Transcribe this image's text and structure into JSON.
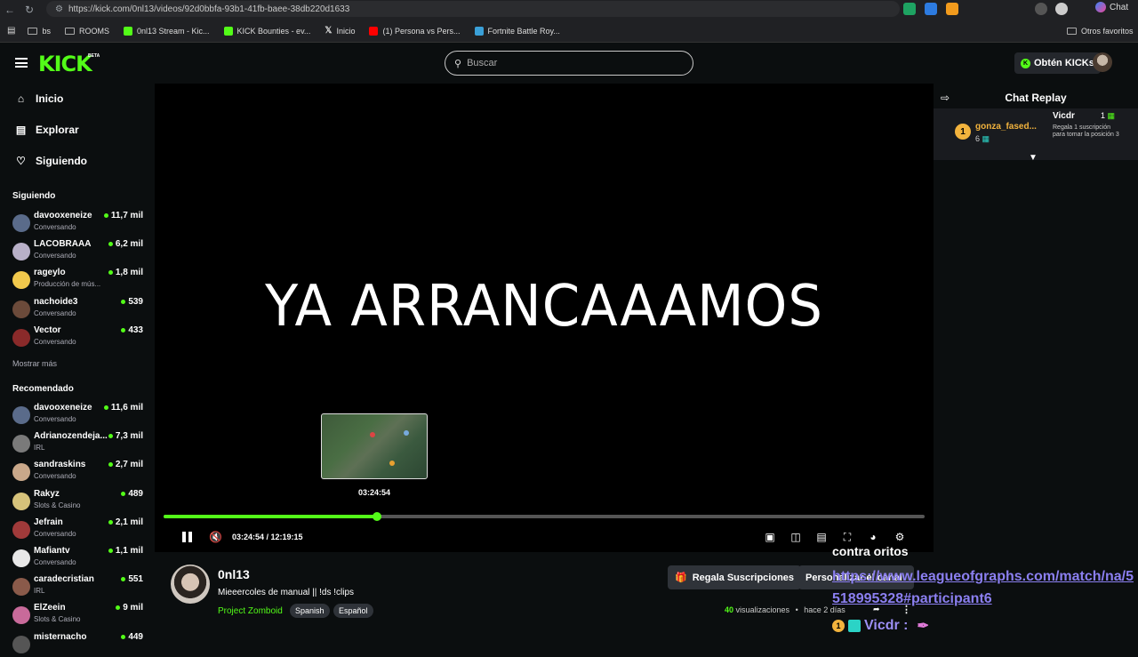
{
  "browser": {
    "url": "https://kick.com/0nl13/videos/92d0bbfa-93b1-41fb-baee-38db220d1633",
    "chat_label": "Chat"
  },
  "bookmarks": {
    "items": [
      {
        "label": "bs",
        "icon": "folder-icon"
      },
      {
        "label": "ROOMS",
        "icon": "folder-icon"
      },
      {
        "label": "0nl13 Stream - Kic...",
        "icon": "kick-icon"
      },
      {
        "label": "KICK Bounties - ev...",
        "icon": "kick-icon"
      },
      {
        "label": "Inicio",
        "icon": "x-icon"
      },
      {
        "label": "(1) Persona vs Pers...",
        "icon": "youtube-icon"
      },
      {
        "label": "Fortnite Battle Roy...",
        "icon": "tab-icon"
      }
    ],
    "other": "Otros favoritos"
  },
  "header": {
    "logo": "KICK",
    "beta": "BETA",
    "search_placeholder": "Buscar",
    "kicks_label": "Obtén KICKs"
  },
  "sidebar": {
    "nav": [
      {
        "label": "Inicio",
        "icon": "home-icon"
      },
      {
        "label": "Explorar",
        "icon": "browse-icon"
      },
      {
        "label": "Siguiendo",
        "icon": "heart-icon"
      }
    ],
    "following_title": "Siguiendo",
    "following": [
      {
        "name": "davooxeneize",
        "category": "Conversando",
        "viewers": "11,7 mil",
        "color": "#5a6b8a"
      },
      {
        "name": "LACOBRAAA",
        "category": "Conversando",
        "viewers": "6,2 mil",
        "color": "#b8b0c8"
      },
      {
        "name": "rageylo",
        "category": "Producción de mús...",
        "viewers": "1,8 mil",
        "color": "#f2c94c"
      },
      {
        "name": "nachoide3",
        "category": "Conversando",
        "viewers": "539",
        "color": "#6b4a3a"
      },
      {
        "name": "Vector",
        "category": "Conversando",
        "viewers": "433",
        "color": "#8a2a2a"
      }
    ],
    "show_more": "Mostrar más",
    "recommended_title": "Recomendado",
    "recommended": [
      {
        "name": "davooxeneize",
        "category": "Conversando",
        "viewers": "11,6 mil",
        "color": "#5a6b8a"
      },
      {
        "name": "Adrianozendeja...",
        "category": "IRL",
        "viewers": "7,3 mil",
        "color": "#7a7a7a"
      },
      {
        "name": "sandraskins",
        "category": "Conversando",
        "viewers": "2,7 mil",
        "color": "#c9a88a"
      },
      {
        "name": "Rakyz",
        "category": "Slots & Casino",
        "viewers": "489",
        "color": "#d6c27a"
      },
      {
        "name": "Jefrain",
        "category": "Conversando",
        "viewers": "2,1 mil",
        "color": "#a03a3a"
      },
      {
        "name": "Mafiantv",
        "category": "Conversando",
        "viewers": "1,1 mil",
        "color": "#e8e8e8"
      },
      {
        "name": "caradecristian",
        "category": "IRL",
        "viewers": "551",
        "color": "#8a5a4a"
      },
      {
        "name": "ElZeein",
        "category": "Slots & Casino",
        "viewers": "9 mil",
        "color": "#c86a9a"
      },
      {
        "name": "misternacho",
        "category": "",
        "viewers": "449",
        "color": "#555"
      }
    ]
  },
  "player": {
    "video_text": "YA ARRANCAAAMOS",
    "preview_time": "03:24:54",
    "current_time": "03:24:54",
    "duration": "12:19:15",
    "time_display": "03:24:54 / 12:19:15",
    "progress": 0.2808
  },
  "chat": {
    "title": "Chat Replay",
    "pinned": {
      "gifter": "gonza_fased...",
      "gift_rank": "1",
      "gift_count": "6",
      "user": "Vicdr",
      "user_count": "1",
      "description": "Regala 1 suscripción para tomar la posición 3"
    }
  },
  "stream_info": {
    "streamer": "0nl13",
    "title": "Mieeercoles de manual || !ds !clips",
    "category": "Project Zomboid",
    "tags": [
      "Spanish",
      "Español"
    ],
    "gift_subs_label": "Regala Suscripciones",
    "customize_label": "Personalizar el canal",
    "views_count": "40",
    "views_label": "visualizaciones",
    "age": "hace 2 días"
  },
  "overlay": {
    "label": "contra oritos",
    "link": "https://www.leagueofgraphs.com/match/na/5518995328#participant6",
    "user": "Vicdr :"
  },
  "colors": {
    "accent": "#53fc18",
    "background": "#0b0e0f",
    "surface": "#2f3339"
  }
}
